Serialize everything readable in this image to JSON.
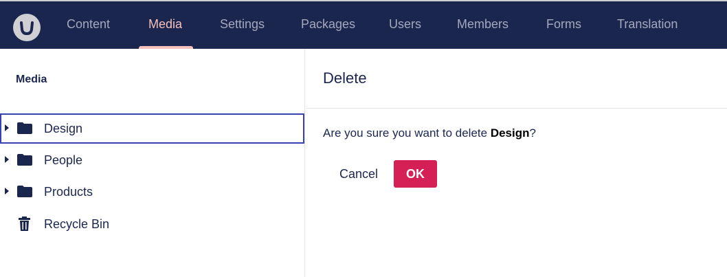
{
  "header": {
    "logo_icon": "umbraco-logo-icon",
    "nav_items": [
      {
        "label": "Content"
      },
      {
        "label": "Media",
        "active": true
      },
      {
        "label": "Settings"
      },
      {
        "label": "Packages"
      },
      {
        "label": "Users"
      },
      {
        "label": "Members"
      },
      {
        "label": "Forms"
      },
      {
        "label": "Translation"
      }
    ]
  },
  "tree": {
    "title": "Media",
    "items": [
      {
        "label": "Design",
        "icon": "folder-icon",
        "expandable": true,
        "selected": true
      },
      {
        "label": "People",
        "icon": "folder-icon",
        "expandable": true
      },
      {
        "label": "Products",
        "icon": "folder-icon",
        "expandable": true
      },
      {
        "label": "Recycle Bin",
        "icon": "trash-icon",
        "expandable": false
      }
    ]
  },
  "dialog": {
    "title": "Delete",
    "question_prefix": "Are you sure you want to delete ",
    "item_name": "Design",
    "question_suffix": "?",
    "cancel_label": "Cancel",
    "ok_label": "OK"
  },
  "colors": {
    "header_bg": "#1b264f",
    "nav_text": "#a5a9bd",
    "nav_active": "#f5c1bc",
    "selection_border": "#3544b1",
    "ok_button": "#d42054"
  }
}
